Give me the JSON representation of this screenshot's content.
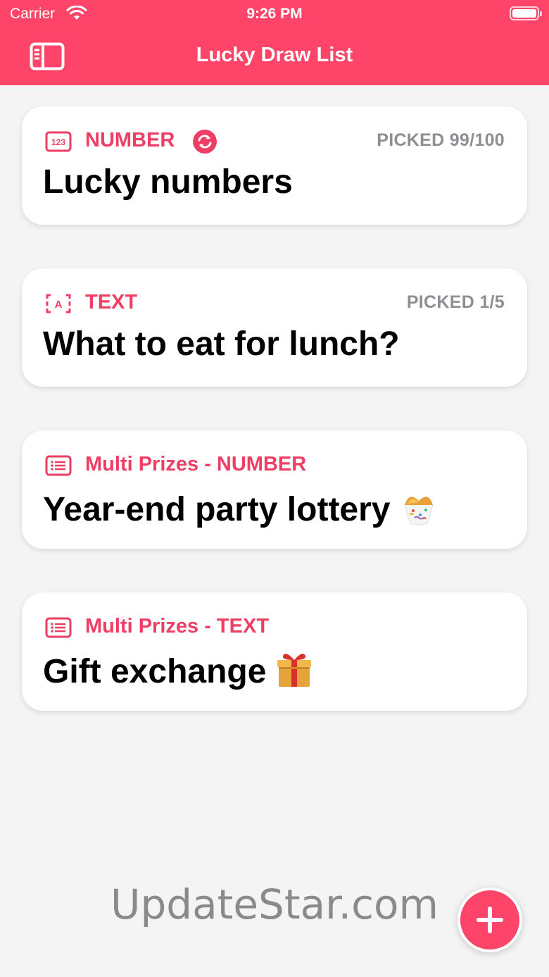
{
  "status_bar": {
    "carrier": "Carrier",
    "time": "9:26 PM"
  },
  "nav": {
    "title": "Lucky Draw List",
    "sidebar_icon": "sidebar-icon"
  },
  "colors": {
    "accent": "#fe4468",
    "type_label": "#ef3e64",
    "picked": "#8e8e93"
  },
  "draws": [
    {
      "icon": "number-123-icon",
      "type": "NUMBER",
      "repeat_icon": "repeat-icon",
      "picked": "PICKED 99/100",
      "title": "Lucky numbers"
    },
    {
      "icon": "text-a-icon",
      "type": "TEXT",
      "picked": "PICKED 1/5",
      "title": "What to eat for lunch?"
    },
    {
      "icon": "list-icon",
      "type": "Multi Prizes - NUMBER",
      "title": "Year-end party lottery",
      "emoji": "confetti-ball-icon"
    },
    {
      "icon": "list-icon",
      "type": "Multi Prizes - TEXT",
      "title": "Gift exchange",
      "emoji": "gift-icon"
    }
  ],
  "watermark": "UpdateStar.com",
  "fab_icon": "plus-icon"
}
